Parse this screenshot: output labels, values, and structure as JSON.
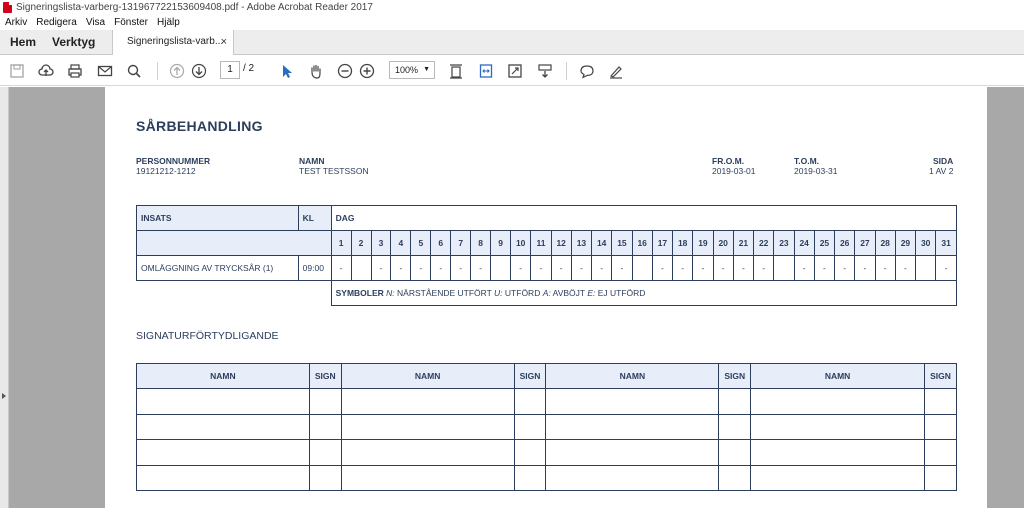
{
  "window": {
    "title": "Signeringslista-varberg-131967722153609408.pdf - Adobe Acrobat Reader 2017"
  },
  "menu": [
    "Arkiv",
    "Redigera",
    "Visa",
    "Fönster",
    "Hjälp"
  ],
  "tabs": {
    "home": "Hem",
    "tools": "Verktyg",
    "document": "Signeringslista-varb...",
    "close": "×"
  },
  "toolbar": {
    "page_current": "1",
    "page_total": "/ 2",
    "zoom": "100%"
  },
  "document": {
    "title": "SÅRBEHANDLING",
    "personnummer_label": "PERSONNUMMER",
    "personnummer": "19121212-1212",
    "namn_label": "NAMN",
    "namn": "TEST TESTSSON",
    "from_label": "FR.O.M.",
    "from": "2019-03-01",
    "tom_label": "T.O.M.",
    "tom": "2019-03-31",
    "sida_label": "SIDA",
    "sida": "1 AV 2",
    "table": {
      "insats_header": "INSATS",
      "kl_header": "KL",
      "dag_header": "DAG",
      "days": [
        "1",
        "2",
        "3",
        "4",
        "5",
        "6",
        "7",
        "8",
        "9",
        "10",
        "11",
        "12",
        "13",
        "14",
        "15",
        "16",
        "17",
        "18",
        "19",
        "20",
        "21",
        "22",
        "23",
        "24",
        "25",
        "26",
        "27",
        "28",
        "29",
        "30",
        "31"
      ],
      "row": {
        "insats": "OMLÄGGNING AV TRYCKSÅR (1)",
        "kl": "09:00",
        "cells": [
          "-",
          "",
          "-",
          "-",
          "-",
          "-",
          "-",
          "-",
          "",
          "-",
          "-",
          "-",
          "-",
          "-",
          "-",
          "",
          "-",
          "-",
          "-",
          "-",
          "-",
          "-",
          "",
          "-",
          "-",
          "-",
          "-",
          "-",
          "-",
          "",
          "-"
        ]
      },
      "symbols_label": "SYMBOLER",
      "symbols": [
        {
          "code": "N:",
          "text": "NÄRSTÅENDE UTFÖRT"
        },
        {
          "code": "U:",
          "text": "UTFÖRD"
        },
        {
          "code": "A:",
          "text": "AVBÖJT"
        },
        {
          "code": "E:",
          "text": "EJ UTFÖRD"
        }
      ]
    },
    "signature_title": "SIGNATURFÖRTYDLIGANDE",
    "signature_headers": [
      "NAMN",
      "SIGN",
      "NAMN",
      "SIGN",
      "NAMN",
      "SIGN",
      "NAMN",
      "SIGN"
    ]
  },
  "colors": {
    "ink": "#2c3e5c",
    "header_fill": "#e8eef9",
    "viewer_bg": "#a8a8a8",
    "icon_blue": "#2b6cc4"
  }
}
